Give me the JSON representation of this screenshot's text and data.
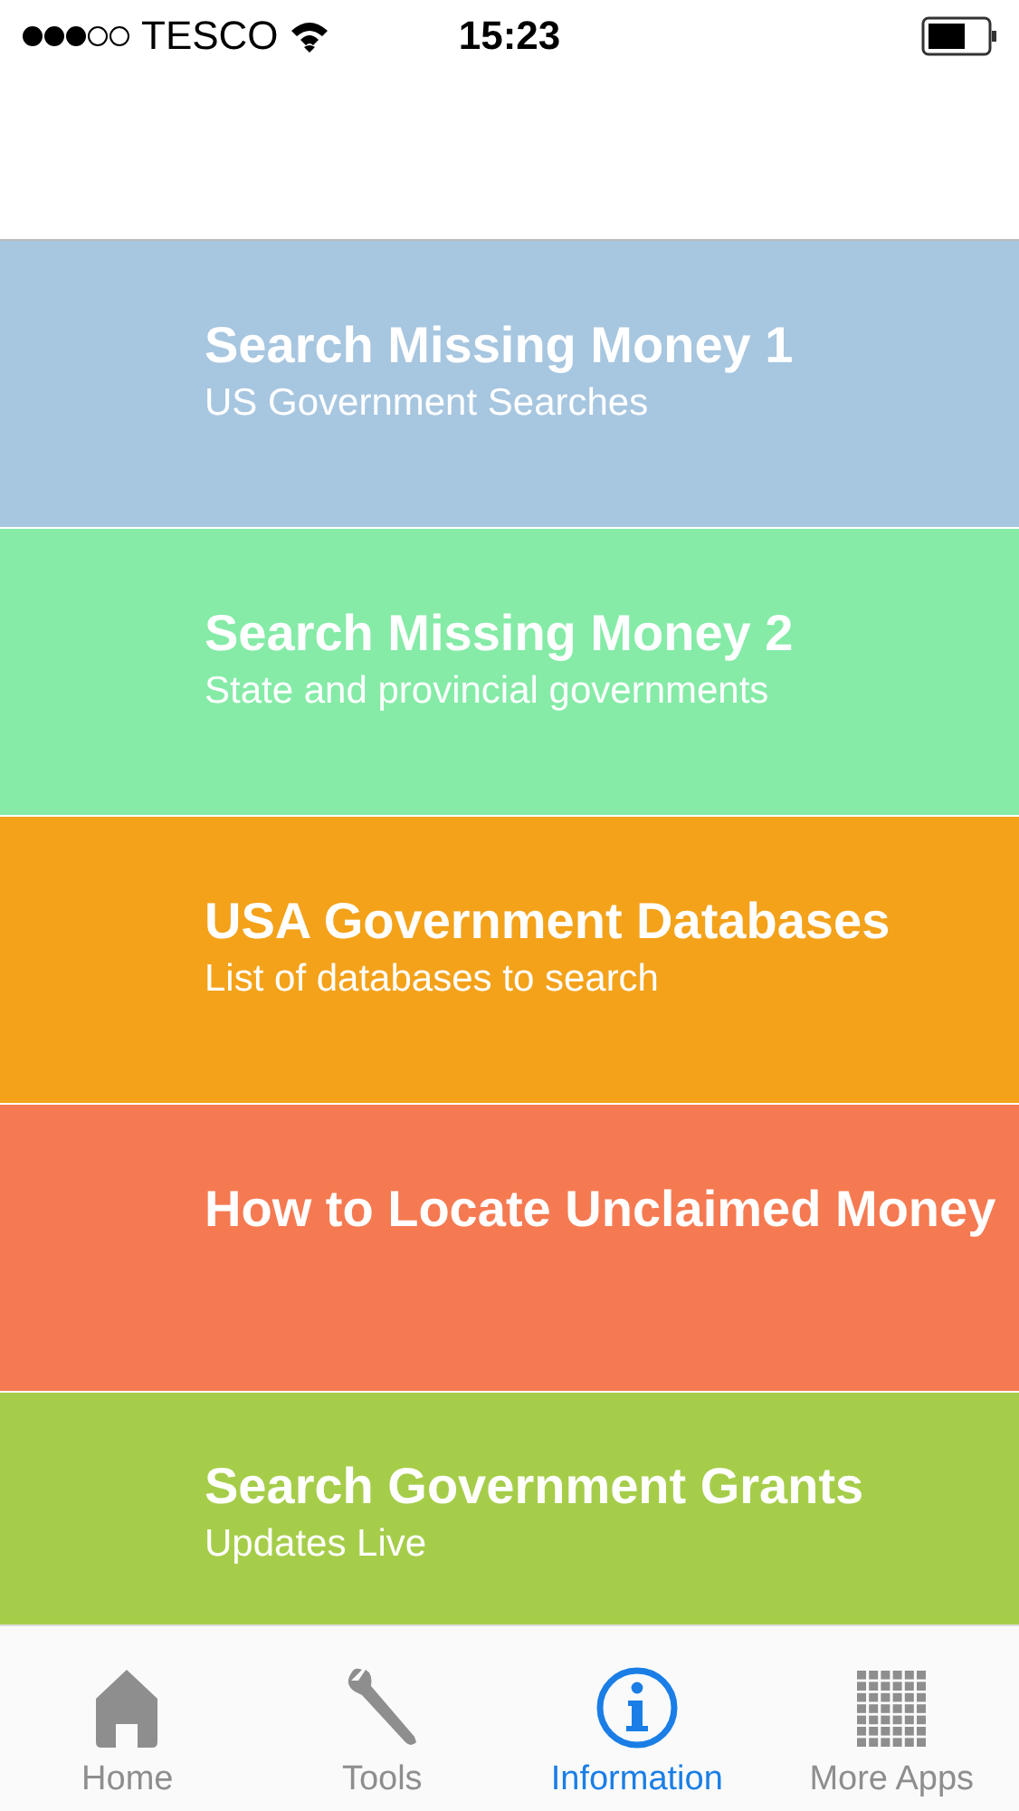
{
  "status_bar": {
    "carrier": "TESCO",
    "time": "15:23"
  },
  "menu": [
    {
      "title": "Search Missing Money 1",
      "subtitle": "US Government Searches",
      "color": "#a7c6e0"
    },
    {
      "title": "Search Missing Money 2",
      "subtitle": "State and provincial governments",
      "color": "#85eba7"
    },
    {
      "title": "USA Government Databases",
      "subtitle": "List of databases to search",
      "color": "#f3a21a"
    },
    {
      "title": "How to Locate Unclaimed Money",
      "color": "#f57a52"
    },
    {
      "title": "Search Government Grants",
      "subtitle": "Updates Live",
      "color": "#a6cd4a"
    }
  ],
  "tabs": [
    {
      "label": "Home",
      "selected": false
    },
    {
      "label": "Tools",
      "selected": false
    },
    {
      "label": "Information",
      "selected": true
    },
    {
      "label": "More Apps",
      "selected": false
    }
  ]
}
